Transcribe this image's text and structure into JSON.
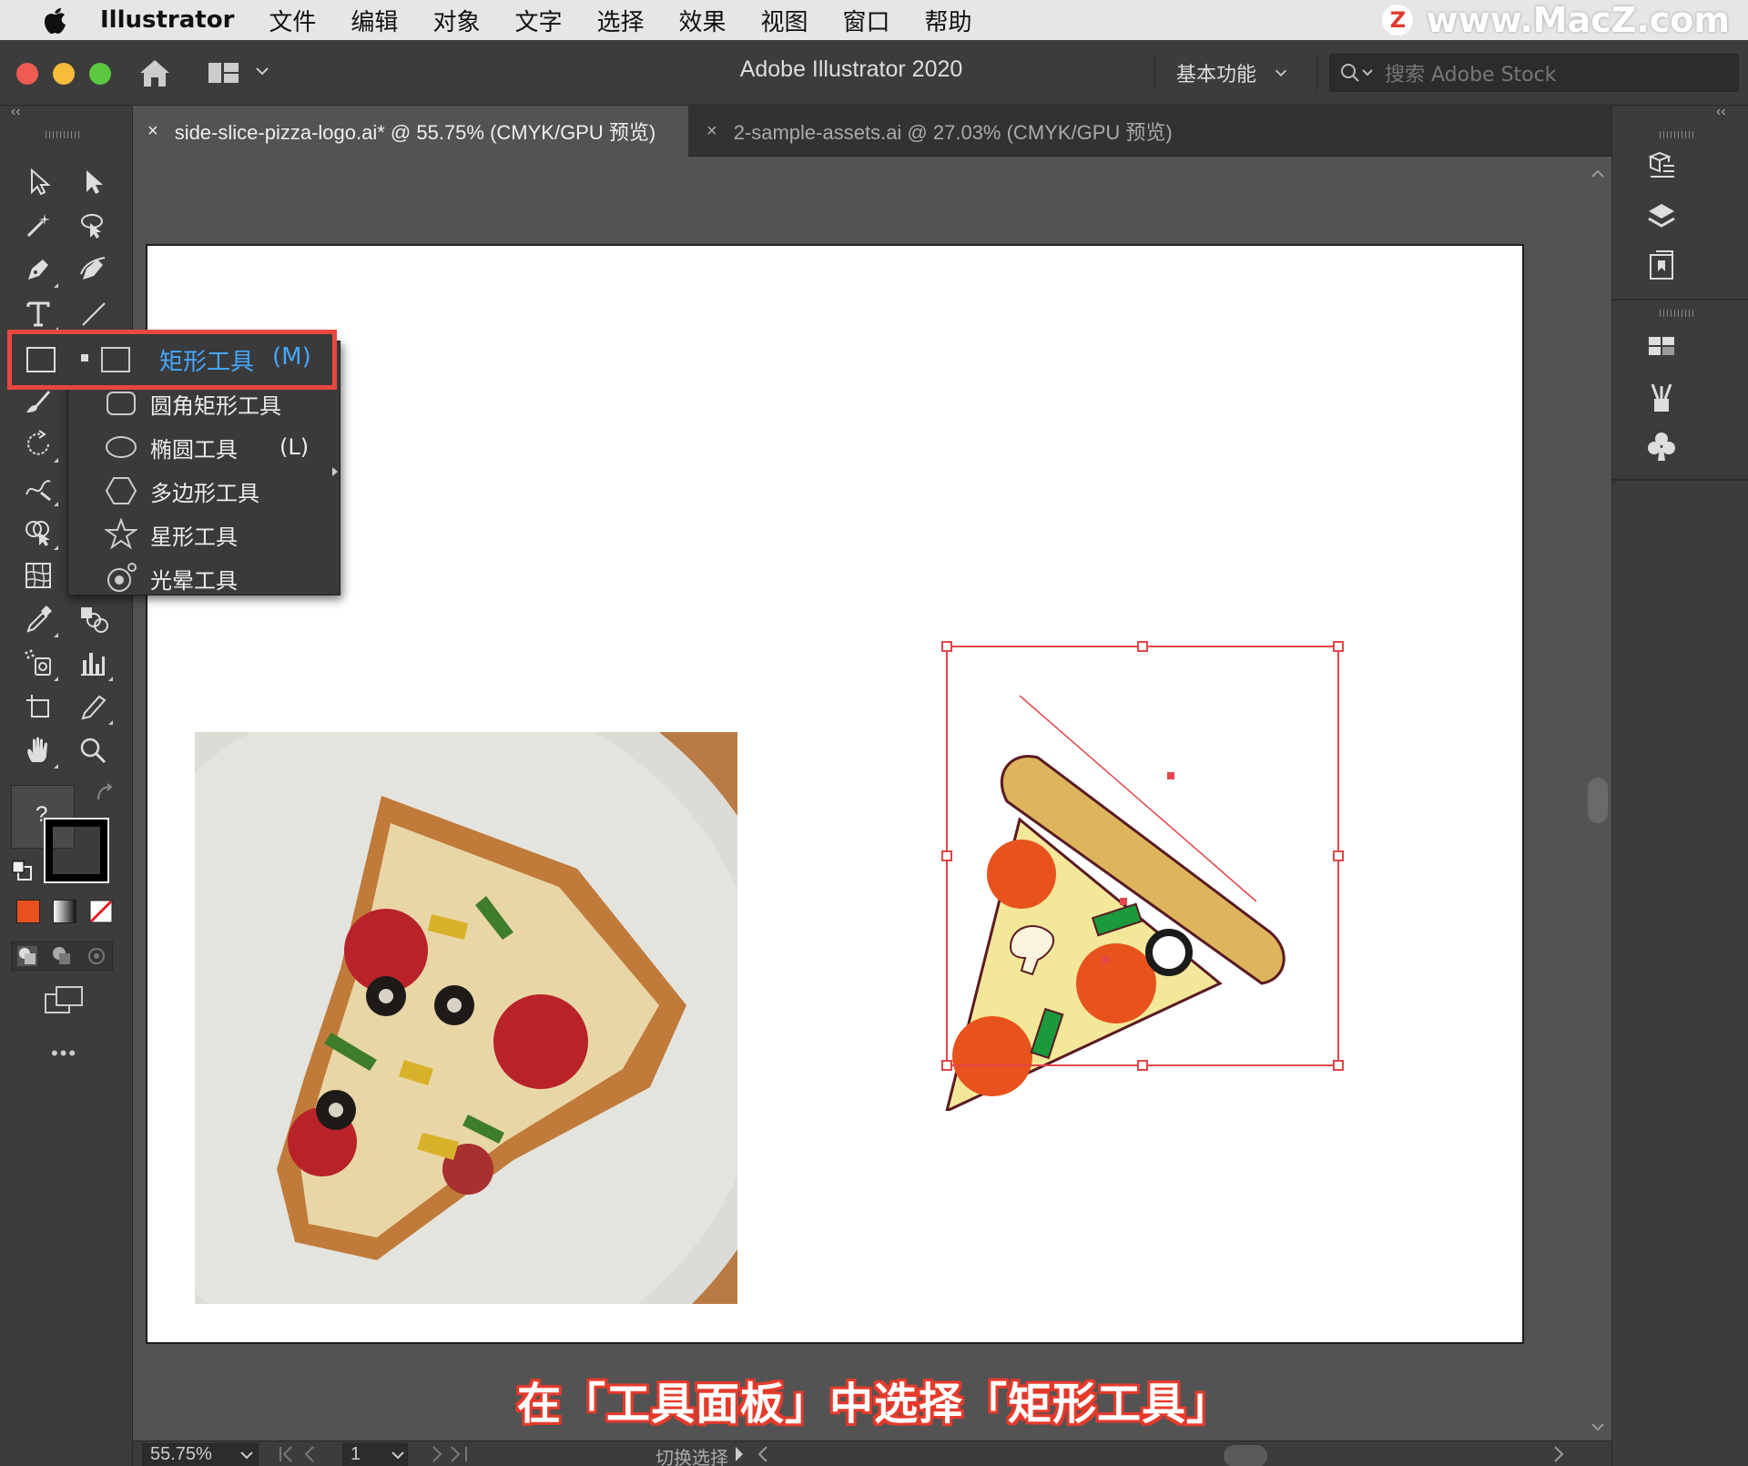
{
  "menubar": {
    "app_name": "Illustrator",
    "items": [
      "文件",
      "编辑",
      "对象",
      "文字",
      "选择",
      "效果",
      "视图",
      "窗口",
      "帮助"
    ]
  },
  "watermark": {
    "logo_letter": "Z",
    "text": "www.MacZ.com"
  },
  "titlebar": {
    "title": "Adobe Illustrator 2020",
    "workspace": "基本功能",
    "search_placeholder": "搜索 Adobe Stock"
  },
  "tabs": [
    {
      "close": "×",
      "label": "side-slice-pizza-logo.ai* @ 55.75% (CMYK/GPU 预览)",
      "active": true
    },
    {
      "close": "×",
      "label": "2-sample-assets.ai @ 27.03% (CMYK/GPU 预览)",
      "active": false
    }
  ],
  "toolbar": {
    "collapse": "‹‹",
    "fill_question": "?",
    "more": "•••"
  },
  "dock": {
    "collapse": "‹‹"
  },
  "flyout": {
    "items": [
      {
        "label": "矩形工具",
        "key": "(M)",
        "icon": "rectangle-icon",
        "selected": true
      },
      {
        "label": "圆角矩形工具",
        "key": "",
        "icon": "rounded-rectangle-icon"
      },
      {
        "label": "椭圆工具",
        "key": "(L)",
        "icon": "ellipse-icon"
      },
      {
        "label": "多边形工具",
        "key": "",
        "icon": "polygon-icon"
      },
      {
        "label": "星形工具",
        "key": "",
        "icon": "star-icon"
      },
      {
        "label": "光晕工具",
        "key": "",
        "icon": "flare-icon"
      }
    ]
  },
  "caption": "在「工具面板」中选择「矩形工具」",
  "statusbar": {
    "zoom": "55.75%",
    "page": "1",
    "status": "切换选择"
  },
  "colors": {
    "highlight": "#e8483f",
    "selected_text": "#44a7ff",
    "fill_swatch": "#e9501f"
  }
}
